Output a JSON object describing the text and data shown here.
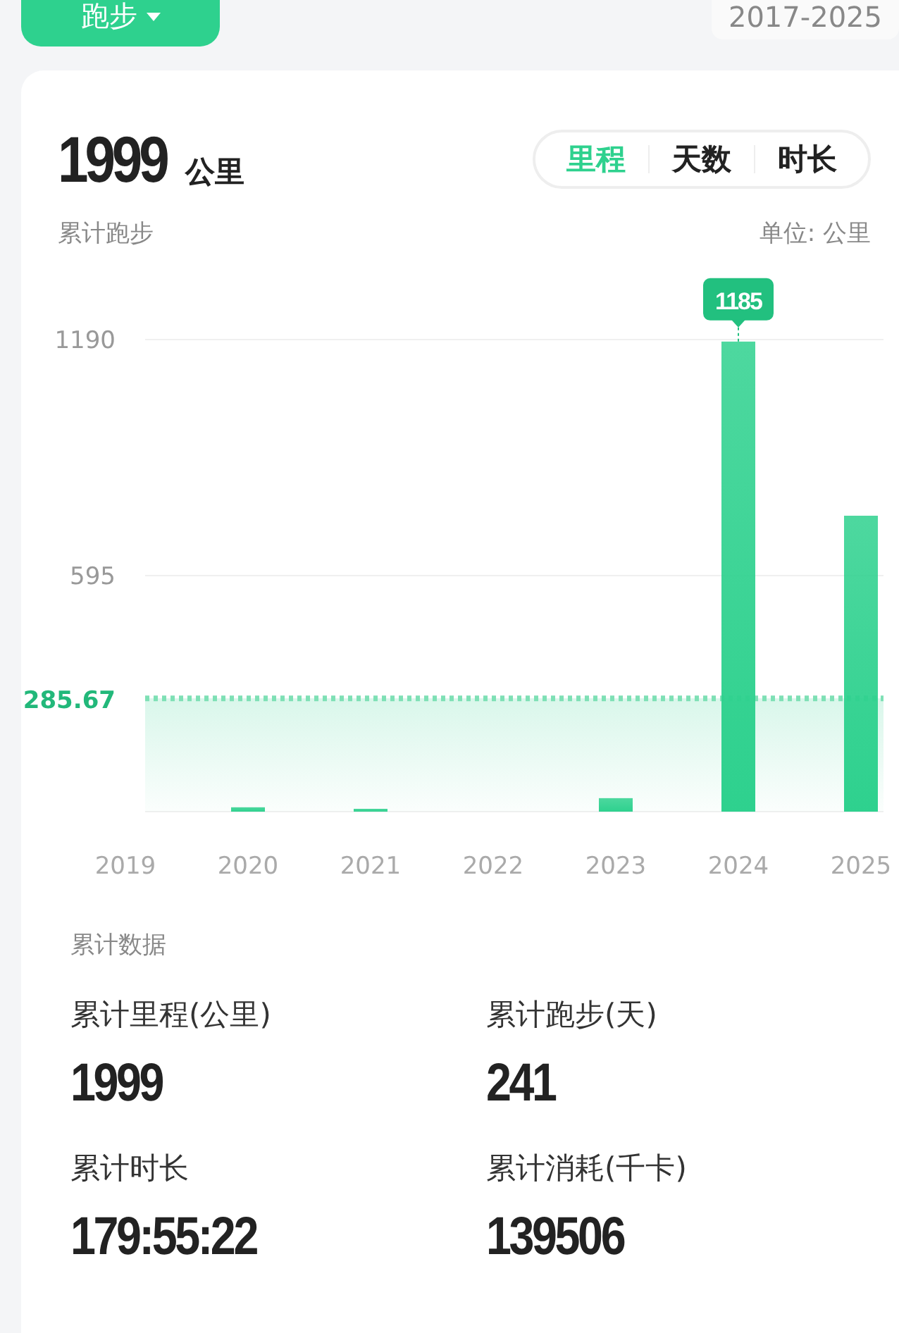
{
  "header": {
    "sport_button": "跑步",
    "date_range": "2017-2025"
  },
  "summary": {
    "total": "1999",
    "unit": "公里",
    "caption": "累计跑步",
    "unit_note": "单位: 公里"
  },
  "metric_tabs": [
    {
      "label": "里程",
      "selected": true
    },
    {
      "label": "天数",
      "selected": false
    },
    {
      "label": "时长",
      "selected": false
    }
  ],
  "chart": {
    "chart_data": {
      "type": "bar",
      "categories": [
        "2019",
        "2020",
        "2021",
        "2022",
        "2023",
        "2024",
        "2025"
      ],
      "series": [
        {
          "color": "#2ed18e",
          "values": [
            0,
            11,
            2,
            0,
            34,
            1185,
            746
          ]
        }
      ],
      "ylim": [
        0,
        1190
      ],
      "yticks": [
        595,
        1190
      ],
      "ref_lines": [
        {
          "axis": "y",
          "value": 285.67,
          "label": "285.67"
        }
      ],
      "bands": [
        {
          "axis": "y",
          "from": 0,
          "to": 285.67
        }
      ],
      "annotations": [
        {
          "text": "1185",
          "x": "2024",
          "y": 1185
        }
      ]
    }
  },
  "stats": {
    "title": "累计数据",
    "items": [
      {
        "label": "累计里程(公里)",
        "value": "1999"
      },
      {
        "label": "累计跑步(天)",
        "value": "241"
      },
      {
        "label": "累计时长",
        "value": "179:55:22"
      },
      {
        "label": "累计消耗(千卡)",
        "value": "139506"
      }
    ]
  }
}
